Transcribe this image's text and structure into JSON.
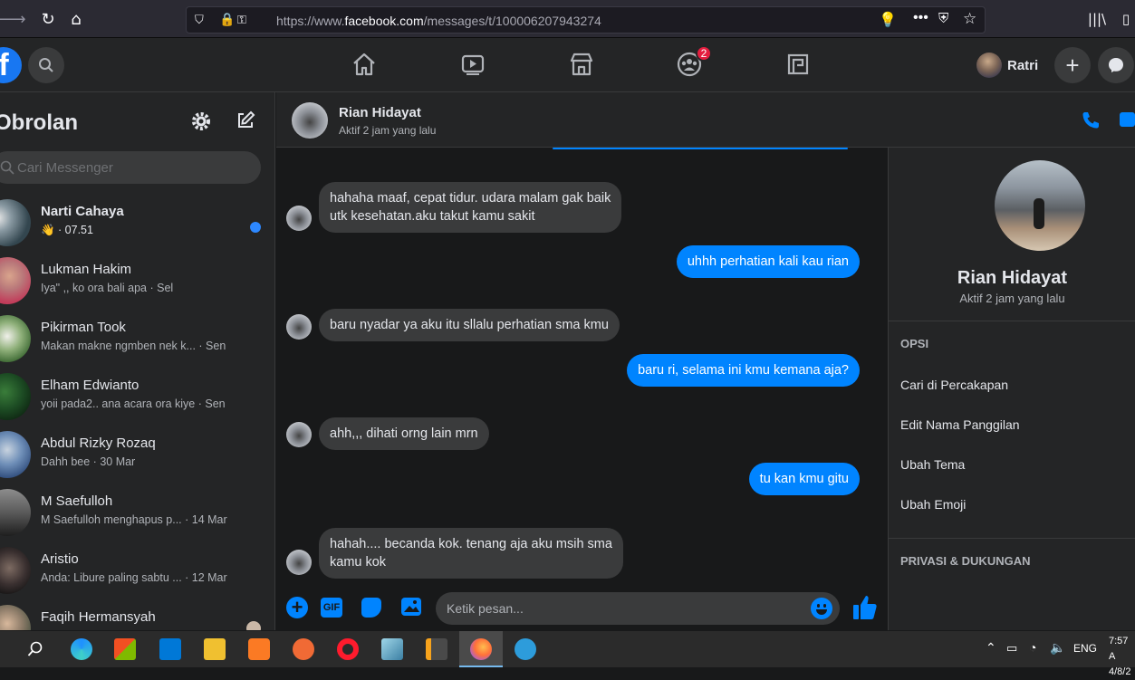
{
  "browser": {
    "url_prefix": "https://www.",
    "url_domain": "facebook.com",
    "url_suffix": "/messages/t/100006207943274"
  },
  "topnav": {
    "groups_badge": "2",
    "profile_name": "Ratri"
  },
  "sidebar": {
    "title": "Obrolan",
    "search_placeholder": "Cari Messenger",
    "conversations": [
      {
        "name": "Narti Cahaya",
        "preview": "👋 · 07.51",
        "unread": true
      },
      {
        "name": "Lukman Hakim",
        "preview": "Iya\" ,, ko ora bali apa · Sel"
      },
      {
        "name": "Pikirman Took",
        "preview": "Makan makne ngmben nek k...   · Sen"
      },
      {
        "name": "Elham Edwianto",
        "preview": "yoii pada2.. ana acara ora kiye · Sen"
      },
      {
        "name": "Abdul Rizky Rozaq",
        "preview": "Dahh bee · 30 Mar"
      },
      {
        "name": "M Saefulloh",
        "preview": "M Saefulloh menghapus p... · 14 Mar"
      },
      {
        "name": "Aristio",
        "preview": "Anda: Libure paling sabtu ... · 12 Mar"
      },
      {
        "name": "Faqih Hermansyah",
        "preview": ""
      }
    ]
  },
  "chat": {
    "contact_name": "Rian Hidayat",
    "contact_status": "Aktif 2 jam yang lalu",
    "messages": [
      {
        "dir": "in",
        "lines": [
          "hahaha maaf, cepat tidur. udara malam gak baik",
          "utk kesehatan.aku takut kamu sakit"
        ]
      },
      {
        "dir": "out",
        "lines": [
          "uhhh perhatian kali kau rian"
        ]
      },
      {
        "dir": "in",
        "lines": [
          "baru nyadar ya aku itu sllalu perhatian sma kmu"
        ]
      },
      {
        "dir": "out",
        "lines": [
          "baru ri, selama ini kmu kemana aja?"
        ]
      },
      {
        "dir": "in",
        "lines": [
          "ahh,,, dihati orng lain mrn"
        ]
      },
      {
        "dir": "out",
        "lines": [
          "tu kan kmu gitu"
        ]
      },
      {
        "dir": "in",
        "lines": [
          "hahah.... becanda kok. tenang aja aku msih sma",
          "kamu kok"
        ]
      }
    ],
    "composer_placeholder": "Ketik pesan...",
    "gif_label": "GIF"
  },
  "info_panel": {
    "name": "Rian Hidayat",
    "status": "Aktif 2 jam yang lalu",
    "options_header": "OPSI",
    "options": [
      "Cari di Percakapan",
      "Edit Nama Panggilan",
      "Ubah Tema",
      "Ubah Emoji"
    ],
    "privacy_header": "PRIVASI & DUKUNGAN"
  },
  "taskbar": {
    "lang": "ENG",
    "time": "7:57 A",
    "date": "4/8/2"
  },
  "colors": {
    "accent": "#0084ff",
    "fb_blue": "#1877f2",
    "panel": "#242526",
    "background": "#18191a"
  }
}
